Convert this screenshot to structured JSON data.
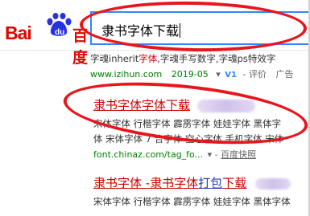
{
  "brand": {
    "logo_latin": "Bai",
    "logo_du": "du",
    "logo_cn": "百度",
    "accent": "#3385ff",
    "red": "#e10601"
  },
  "search": {
    "query": "隶书字体下载"
  },
  "results": [
    {
      "snippet_prefix": "字魂inherit",
      "snippet_hl": "字体",
      "snippet_rest": ",字魂手写数字,字魂ps特效字",
      "url": "www.izihun.com",
      "date": "2019-05",
      "badge": "V1",
      "review_label": "评价",
      "ad_label": "广告"
    },
    {
      "title": "隶书字体字体下载",
      "desc_line1": "宋体字体 行楷字体 霹雳字体 娃娃字体 黑体字",
      "desc_line2": "体 宋体字体 7 合字体 空心字体 手机字体 宋体",
      "url": "font.chinaz.com/tag_fo...",
      "cache_label": "百度快照"
    },
    {
      "title_a": "隶书字体",
      "title_sep": " -",
      "title_b": "隶书字体",
      "title_c": "打包",
      "title_d": "下载",
      "desc_line1": "宋体字体 行楷字体 霹雳字体 娃娃字体 黑体字体"
    }
  ]
}
